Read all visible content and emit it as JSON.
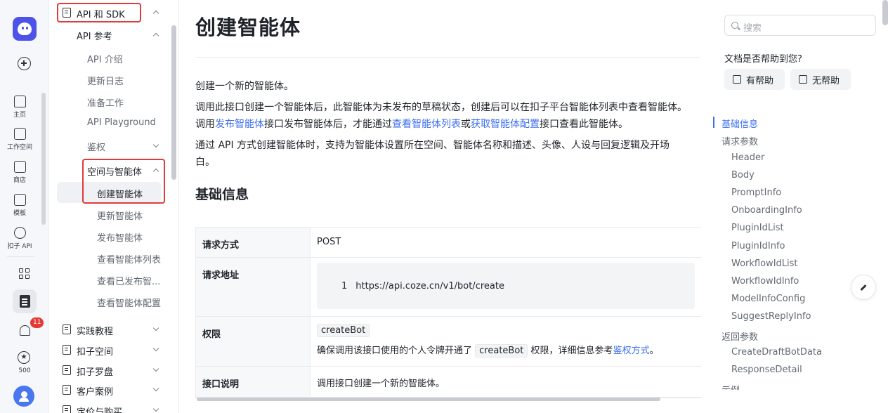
{
  "rail": {
    "items": [
      {
        "label": "主页",
        "icon": "home-icon"
      },
      {
        "label": "工作空间",
        "icon": "terminal-icon"
      },
      {
        "label": "商店",
        "icon": "store-icon"
      },
      {
        "label": "模板",
        "icon": "template-icon"
      },
      {
        "label": "扣子 API",
        "icon": "api-icon"
      }
    ],
    "notification_count": "11",
    "credits": "500"
  },
  "docnav": {
    "section_title": "API 和 SDK",
    "subsection_title": "API 参考",
    "items": [
      "API 介绍",
      "更新日志",
      "准备工作",
      "API Playground",
      "鉴权"
    ],
    "group_title": "空间与智能体",
    "group_items": [
      "创建智能体",
      "更新智能体",
      "发布智能体",
      "查看智能体列表",
      "查看已发布智...",
      "查看智能体配置"
    ],
    "sections": [
      "实践教程",
      "扣子空间",
      "扣子罗盘",
      "客户案例",
      "定价与购买"
    ]
  },
  "main": {
    "title": "创建智能体",
    "intro": "创建一个新的智能体。",
    "para1_a": "调用此接口创建一个智能体后，此智能体为未发布的草稿状态，创建后可以在扣子平台智能体列表中查看智能体。调用",
    "para1_link1": "发布智能体",
    "para1_b": "接口发布智能体后，才能通过",
    "para1_link2": "查看智能体列表",
    "para1_c": "或",
    "para1_link3": "获取智能体配置",
    "para1_d": "接口查看此智能体。",
    "para2": "通过 API 方式创建智能体时，支持为智能体设置所在空间、智能体名称和描述、头像、人设与回复逻辑及开场白。",
    "section_heading": "基础信息",
    "table": {
      "method_label": "请求方式",
      "method_value": "POST",
      "url_label": "请求地址",
      "url_line_no": "1",
      "url_value": "https://api.coze.cn/v1/bot/create",
      "perm_label": "权限",
      "perm_code": "createBot",
      "perm_desc_a": "确保调用该接口使用的个人令牌开通了",
      "perm_desc_code": "createBot",
      "perm_desc_b": "权限，详细信息参考",
      "perm_desc_link": "鉴权方式",
      "perm_desc_c": "。",
      "desc_label": "接口说明",
      "desc_value": "调用接口创建一个新的智能体。"
    }
  },
  "right": {
    "search_placeholder": "搜索",
    "help_question": "文档是否帮助到您?",
    "helpful_label": "有帮助",
    "not_helpful_label": "无帮助",
    "toc": [
      {
        "label": "基础信息",
        "level": 1,
        "active": true
      },
      {
        "label": "请求参数",
        "level": 1
      },
      {
        "label": "Header",
        "level": 2
      },
      {
        "label": "Body",
        "level": 2
      },
      {
        "label": "PromptInfo",
        "level": 2
      },
      {
        "label": "OnboardingInfo",
        "level": 2
      },
      {
        "label": "PluginIdList",
        "level": 2
      },
      {
        "label": "PluginIdInfo",
        "level": 2
      },
      {
        "label": "WorkflowIdList",
        "level": 2
      },
      {
        "label": "WorkflowIdInfo",
        "level": 2
      },
      {
        "label": "ModelInfoConfig",
        "level": 2
      },
      {
        "label": "SuggestReplyInfo",
        "level": 2
      },
      {
        "label": "返回参数",
        "level": 1
      },
      {
        "label": "CreateDraftBotData",
        "level": 2
      },
      {
        "label": "ResponseDetail",
        "level": 2
      },
      {
        "label": "示例",
        "level": 1
      }
    ]
  }
}
